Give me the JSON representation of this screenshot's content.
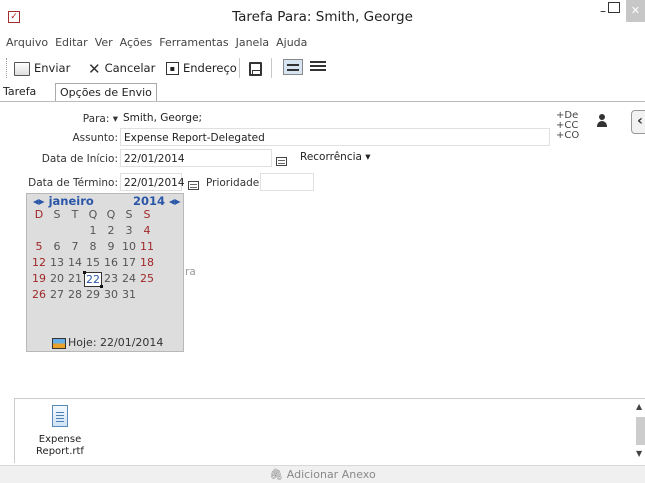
{
  "window": {
    "title": "Tarefa Para: Smith, George",
    "check_icon": "check-box-icon"
  },
  "menu": [
    "Arquivo",
    "Editar",
    "Ver",
    "Ações",
    "Ferramentas",
    "Janela",
    "Ajuda"
  ],
  "toolbar": {
    "send": "Enviar",
    "cancel": "Cancelar",
    "address": "Endereço"
  },
  "tabs": [
    "Tarefa",
    "Opções de Envio"
  ],
  "form": {
    "to_label": "Para:",
    "to_value": "Smith, George;",
    "subject_label": "Assunto:",
    "subject_value": "Expense Report-Delegated",
    "start_label": "Data de Início:",
    "start_value": "22/01/2014",
    "end_label": "Data de Término:",
    "end_value": "22/01/2014",
    "recurrence": "Recorrência",
    "priority_label": "Prioridade:",
    "priority_value": "",
    "cc_links": [
      "+De",
      "+CC",
      "+CO"
    ]
  },
  "calendar": {
    "month": "janeiro",
    "year": "2014",
    "weekdays": [
      "D",
      "S",
      "T",
      "Q",
      "Q",
      "S",
      "S"
    ],
    "weeks": [
      [
        "",
        "",
        "",
        "1",
        "2",
        "3",
        "4"
      ],
      [
        "5",
        "6",
        "7",
        "8",
        "9",
        "10",
        "11"
      ],
      [
        "12",
        "13",
        "14",
        "15",
        "16",
        "17",
        "18"
      ],
      [
        "19",
        "20",
        "21",
        "22",
        "23",
        "24",
        "25"
      ],
      [
        "26",
        "27",
        "28",
        "29",
        "30",
        "31",
        ""
      ]
    ],
    "selected_day": "22",
    "today_label": "Hoje: 22/01/2014"
  },
  "ghost_text": "ra",
  "attachment": {
    "name_line1": "Expense",
    "name_line2": "Report.rtf"
  },
  "bottom_bar": {
    "add_attachment": "Adicionar Anexo"
  }
}
